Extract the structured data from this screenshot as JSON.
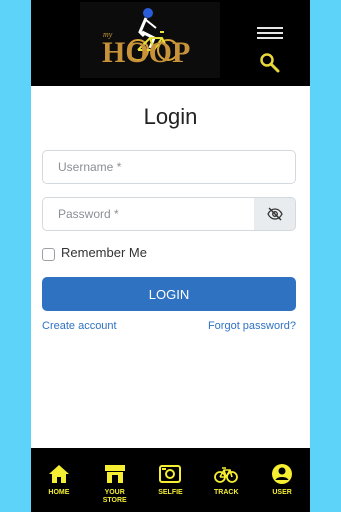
{
  "header": {
    "logo_small": "my",
    "logo_word": "HOOP",
    "menu_icon": "hamburger-menu-icon",
    "search_icon": "search-icon"
  },
  "login": {
    "title": "Login",
    "username_placeholder": "Username *",
    "password_placeholder": "Password *",
    "eye_icon": "eye-slash-icon",
    "remember_label": "Remember Me",
    "remember_checked": false,
    "submit_label": "LOGIN",
    "create_account": "Create account",
    "forgot_password": "Forgot password?"
  },
  "nav": {
    "items": [
      {
        "label": "HOME",
        "icon": "home-icon"
      },
      {
        "label": "YOUR STORE",
        "icon": "store-icon"
      },
      {
        "label": "SELFIE",
        "icon": "camera-icon"
      },
      {
        "label": "TRACK",
        "icon": "bicycle-icon"
      },
      {
        "label": "USER",
        "icon": "user-icon"
      }
    ]
  },
  "colors": {
    "background": "#5ed3fa",
    "header": "#000000",
    "accent": "#2f72c2",
    "nav_yellow": "#f5ee32",
    "logo_gold": "#c7923a"
  }
}
